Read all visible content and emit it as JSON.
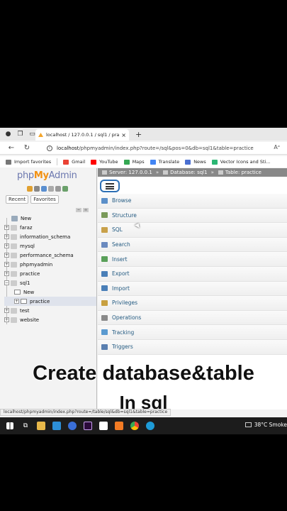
{
  "browser": {
    "tab_title": "localhost / 127.0.0.1 / sql1 / prac",
    "tab_close": "×",
    "new_tab": "+",
    "url_host": "localhost",
    "url_path": "/phpmyadmin/index.php?route=/sql&pos=0&db=sql1&table=practice"
  },
  "bookmarks": [
    {
      "label": "Import favorites",
      "color": "#777777"
    },
    {
      "label": "Gmail",
      "color": "#ea4335"
    },
    {
      "label": "YouTube",
      "color": "#ff0000"
    },
    {
      "label": "Maps",
      "color": "#34a853"
    },
    {
      "label": "Translate",
      "color": "#4285f4"
    },
    {
      "label": "News",
      "color": "#4a6fd1"
    },
    {
      "label": "Vector Icons and Sti...",
      "color": "#2bb673"
    }
  ],
  "left_panel": {
    "logo_php": "php",
    "logo_my": "My",
    "logo_admin": "Admin",
    "recent": "Recent",
    "favorites": "Favorites",
    "tree": [
      {
        "label": "New",
        "level": 0,
        "expander": ""
      },
      {
        "label": "faraz",
        "level": 0,
        "expander": "+"
      },
      {
        "label": "information_schema",
        "level": 0,
        "expander": "+"
      },
      {
        "label": "mysql",
        "level": 0,
        "expander": "+"
      },
      {
        "label": "performance_schema",
        "level": 0,
        "expander": "+"
      },
      {
        "label": "phpmyadmin",
        "level": 0,
        "expander": "+"
      },
      {
        "label": "practice",
        "level": 0,
        "expander": "+"
      },
      {
        "label": "sql1",
        "level": 0,
        "expander": "−"
      },
      {
        "label": "New",
        "level": 1,
        "expander": ""
      },
      {
        "label": "practice",
        "level": 1,
        "expander": "+"
      },
      {
        "label": "test",
        "level": 0,
        "expander": "+"
      },
      {
        "label": "website",
        "level": 0,
        "expander": "+"
      }
    ]
  },
  "breadcrumb": {
    "server": "Server: 127.0.0.1",
    "database": "Database: sql1",
    "table": "Table: practice",
    "separator": "»"
  },
  "menu": [
    {
      "label": "Browse",
      "color": "#5b8fc9"
    },
    {
      "label": "Structure",
      "color": "#7a9a5a"
    },
    {
      "label": "SQL",
      "color": "#c9a14a"
    },
    {
      "label": "Search",
      "color": "#6a8abf"
    },
    {
      "label": "Insert",
      "color": "#5aa05a"
    },
    {
      "label": "Export",
      "color": "#4a7fb8"
    },
    {
      "label": "Import",
      "color": "#4a7fb8"
    },
    {
      "label": "Privileges",
      "color": "#c8a040"
    },
    {
      "label": "Operations",
      "color": "#8a8a8a"
    },
    {
      "label": "Tracking",
      "color": "#5a9ad0"
    },
    {
      "label": "Triggers",
      "color": "#5a7fb0"
    }
  ],
  "caption": {
    "line1": "Create database&table",
    "line2": "In sql"
  },
  "status_url": "localhost/phpmyadmin/index.php?route=/table/sql&db=sql1&table=practice",
  "taskbar": {
    "weather": "38°C Smoke"
  }
}
